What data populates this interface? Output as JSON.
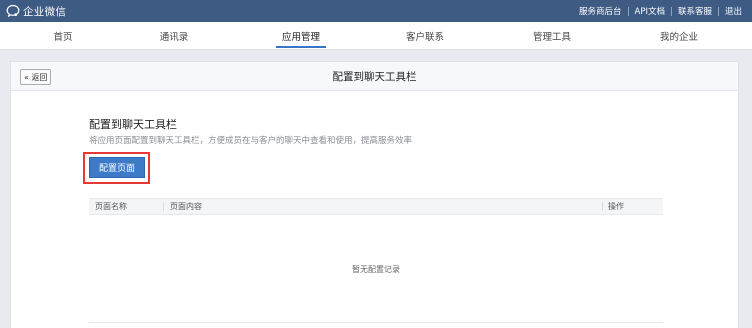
{
  "topbar": {
    "brand": "企业微信",
    "links": [
      "服务商后台",
      "API文档",
      "联系客服",
      "退出"
    ]
  },
  "nav": {
    "items": [
      "首页",
      "通讯录",
      "应用管理",
      "客户联系",
      "管理工具",
      "我的企业"
    ],
    "active": "应用管理"
  },
  "header": {
    "back_label": "« 返回",
    "title": "配置到聊天工具栏"
  },
  "section": {
    "title": "配置到聊天工具栏",
    "description": "将应用页面配置到聊天工具栏，方便成员在与客户的聊天中查看和使用，提高服务效率",
    "button_label": "配置页面"
  },
  "table": {
    "columns": [
      "页面名称",
      "页面内容",
      "操作"
    ],
    "empty_text": "暂无配置记录"
  },
  "colors": {
    "topbar": "#3e5b83",
    "accent": "#3d7bc9",
    "highlight": "#e53935"
  }
}
